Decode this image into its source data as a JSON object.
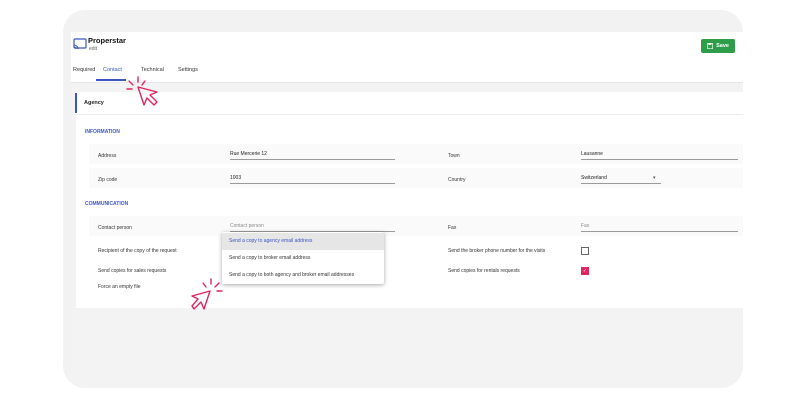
{
  "header": {
    "app_name": "Properstar",
    "subtitle": "edit",
    "save_label": "Save"
  },
  "tabs": [
    {
      "label": "Required"
    },
    {
      "label": "Contact",
      "active": true
    },
    {
      "label": "Technical"
    },
    {
      "label": "Settings"
    }
  ],
  "section": {
    "title": "Agency"
  },
  "information": {
    "title": "INFORMATION",
    "address": {
      "label": "Address",
      "value": "Rue Mercerie 12"
    },
    "town": {
      "label": "Town",
      "value": "Lausanne"
    },
    "zip": {
      "label": "Zip code",
      "value": "1003"
    },
    "country": {
      "label": "Country",
      "value": "Switzerland"
    }
  },
  "communication": {
    "title": "COMMUNICATION",
    "contact_person": {
      "label": "Contact person",
      "placeholder": "Contact person"
    },
    "fax": {
      "label": "Fax",
      "placeholder": "Fax"
    },
    "recipient": {
      "label": "Recipient of the copy of the request"
    },
    "broker_phone": {
      "label": "Send the broker phone number for the visits",
      "checked": false
    },
    "sales_copies": {
      "label": "Send copies for sales requests"
    },
    "rentals_copies": {
      "label": "Send copies for rentals requests",
      "checked": true
    },
    "force_empty": {
      "label": "Force an empty file"
    }
  },
  "dropdown": {
    "options": [
      "Send a copy to agency email address",
      "Send a copy to broker email address",
      "Send a copy to both agency and broker email addresses"
    ],
    "highlighted_index": 0
  },
  "colors": {
    "accent": "#3b56c4",
    "save": "#2e9d4a",
    "highlight": "#e0245e"
  }
}
